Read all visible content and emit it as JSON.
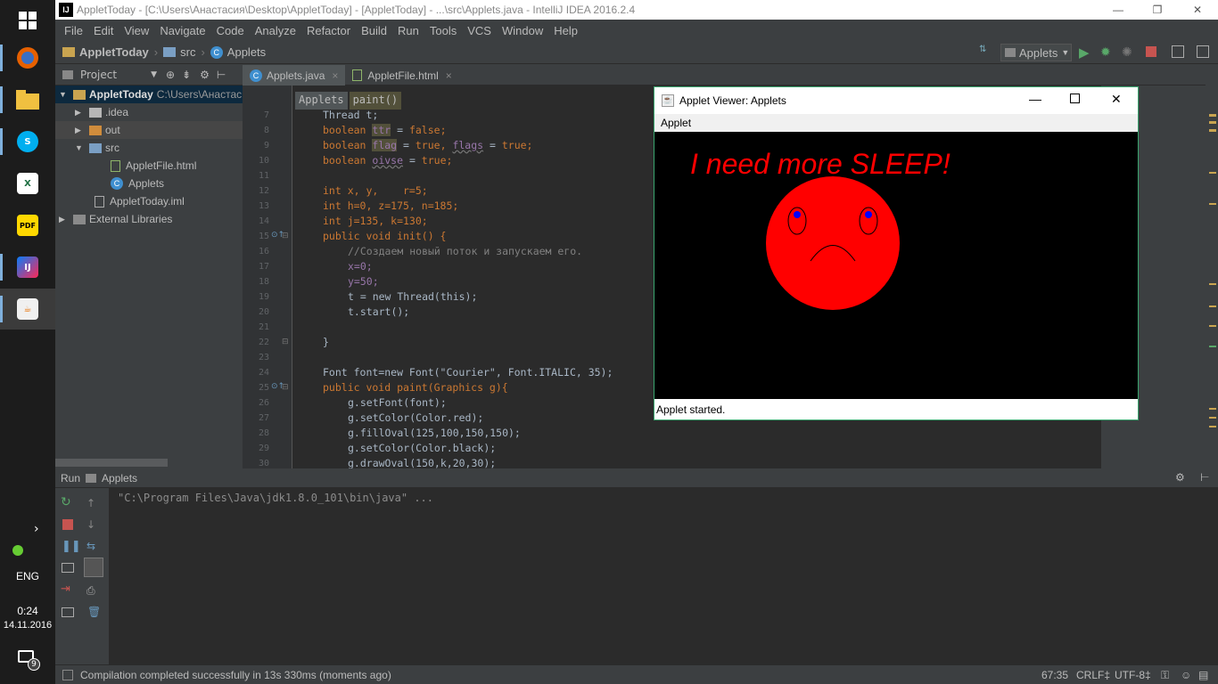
{
  "window": {
    "title": "AppletToday - [C:\\Users\\Анастасия\\Desktop\\AppletToday] - [AppletToday] - ...\\src\\Applets.java - IntelliJ IDEA 2016.2.4",
    "minimize": "—",
    "maximize": "❐",
    "close": "✕"
  },
  "menu": [
    "File",
    "Edit",
    "View",
    "Navigate",
    "Code",
    "Analyze",
    "Refactor",
    "Build",
    "Run",
    "Tools",
    "VCS",
    "Window",
    "Help"
  ],
  "navbar": {
    "project": "AppletToday",
    "folder": "src",
    "file": "Applets",
    "run_config": "Applets"
  },
  "project_panel": {
    "title": "Project",
    "tree": [
      {
        "label": "AppletToday",
        "extra": "C:\\Users\\Анастас",
        "level": 0,
        "arrow": "▼",
        "icon": "folder-icon"
      },
      {
        "label": ".idea",
        "level": 1,
        "arrow": "▶",
        "icon": "folder-icon"
      },
      {
        "label": "out",
        "level": 1,
        "arrow": "▶",
        "icon": "folder-orange-icon"
      },
      {
        "label": "src",
        "level": 1,
        "arrow": "▼",
        "icon": "folder-blue-icon"
      },
      {
        "label": "AppletFile.html",
        "level": 2,
        "arrow": "",
        "icon": "html-file-icon"
      },
      {
        "label": "Applets",
        "level": 2,
        "arrow": "",
        "icon": "class-icon"
      },
      {
        "label": "AppletToday.iml",
        "level": 1,
        "arrow": "",
        "icon": "iml-file-icon"
      },
      {
        "label": "External Libraries",
        "level": 0,
        "arrow": "▶",
        "icon": "library-icon"
      }
    ]
  },
  "tabs": [
    {
      "label": "Applets.java",
      "close": "×"
    },
    {
      "label": "AppletFile.html",
      "close": "×"
    }
  ],
  "breadcrumbs": [
    "Applets",
    "paint()"
  ],
  "code": {
    "line_numbers": [
      "7",
      "8",
      "9",
      "10",
      "11",
      "12",
      "13",
      "14",
      "15",
      "16",
      "17",
      "18",
      "19",
      "20",
      "21",
      "22",
      "23",
      "24",
      "25",
      "26",
      "27",
      "28",
      "29",
      "30"
    ],
    "l7": "Thread t;",
    "l8a": "boolean ",
    "l8b": "ttr",
    "l8c": " = ",
    "l8d": "false",
    "l8e": ";",
    "l9a": "boolean ",
    "l9b": "flag",
    "l9c": " = ",
    "l9d": "true",
    "l9e": ", ",
    "l9f": "flags",
    "l9g": " = ",
    "l9h": "true",
    "l9i": ";",
    "l10a": "boolean ",
    "l10b": "oivse",
    "l10c": " = ",
    "l10d": "true",
    "l10e": ";",
    "l12": "int x, y,    r=5;",
    "l13": "int h=0, z=175, n=185;",
    "l14": "int j=135, k=130;",
    "l15": "public void init() {",
    "l16": "//Создаем новый поток и запускаем его.",
    "l17": "x=0;",
    "l18": "y=50;",
    "l19": "t = new Thread(this);",
    "l20": "t.start();",
    "l22": "}",
    "l24": "Font font=new Font(\"Courier\", Font.ITALIC, 35);",
    "l25": "public void paint(Graphics g){",
    "l26": "g.setFont(font);",
    "l27": "g.setColor(Color.red);",
    "l28": "g.fillOval(125,100,150,150);",
    "l29": "g.setColor(Color.black);",
    "l30": "g.drawOval(150,k,20,30);"
  },
  "run_panel": {
    "run_label": "Run",
    "config": "Applets",
    "console_line": "\"C:\\Program Files\\Java\\jdk1.8.0_101\\bin\\java\" ..."
  },
  "status": {
    "message": "Compilation completed successfully in 13s 330ms (moments ago)",
    "position": "67:35",
    "line_sep": "CRLF‡",
    "encoding": "UTF-8‡"
  },
  "taskbar": {
    "lang": "ENG",
    "time": "0:24",
    "date": "14.11.2016",
    "notifications": "9"
  },
  "applet_viewer": {
    "title": "Applet Viewer: Applets",
    "menu": "Applet",
    "canvas_text": "I need more SLEEP!",
    "status": "Applet started."
  },
  "colors": {
    "accent": "#3aa56f",
    "face": "#ff0000",
    "eyes": "#0000ff",
    "canvas_text": "#ff0000"
  }
}
